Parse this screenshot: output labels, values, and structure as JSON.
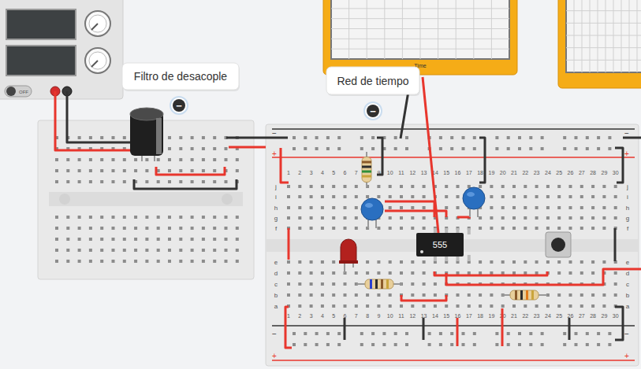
{
  "labels": [
    {
      "text": "Filtro de desacople",
      "icon": "−"
    },
    {
      "text": "Red de tiempo",
      "icon": "−"
    }
  ],
  "power_supply": {
    "switch": "OFF",
    "on": false
  },
  "oscilloscopes": [
    {
      "axis_label": "Time"
    },
    {}
  ],
  "chip": {
    "label": "555"
  },
  "breadboard": {
    "columns": [
      "1",
      "2",
      "3",
      "4",
      "5",
      "6",
      "7",
      "8",
      "9",
      "10",
      "11",
      "12",
      "13",
      "14",
      "15",
      "16",
      "17",
      "18",
      "19",
      "20",
      "21",
      "22",
      "23",
      "24",
      "25",
      "26",
      "27",
      "28",
      "29",
      "30"
    ],
    "rows_top": [
      "j",
      "i",
      "h",
      "g",
      "f"
    ],
    "rows_bottom": [
      "e",
      "d",
      "c",
      "b",
      "a"
    ],
    "rail_minus": "−",
    "rail_plus": "+"
  },
  "wires": [
    {
      "color": "#e8362d"
    },
    {
      "color": "#333333"
    },
    {
      "color": "#e8362d"
    },
    {
      "color": "#333333"
    },
    {
      "color": "#333333"
    },
    {
      "color": "#e8362d"
    },
    {
      "color": "#e8362d"
    },
    {
      "color": "#333333"
    },
    {
      "color": "#333333"
    },
    {
      "color": "#e8362d"
    },
    {
      "color": "#333333"
    },
    {
      "color": "#333333"
    },
    {
      "color": "#333333"
    },
    {
      "color": "#e8362d"
    },
    {
      "color": "#e8362d"
    },
    {
      "color": "#e8362d"
    },
    {
      "color": "#e8362d"
    },
    {
      "color": "#e8362d"
    },
    {
      "color": "#e8362d"
    },
    {
      "color": "#e8362d"
    },
    {
      "color": "#e8362d"
    },
    {
      "color": "#333333"
    },
    {
      "color": "#e8362d"
    },
    {
      "color": "#333333"
    },
    {
      "color": "#333333"
    },
    {
      "color": "#e8362d"
    },
    {
      "color": "#e8362d"
    },
    {
      "color": "#333333"
    },
    {
      "color": "#333333"
    }
  ]
}
